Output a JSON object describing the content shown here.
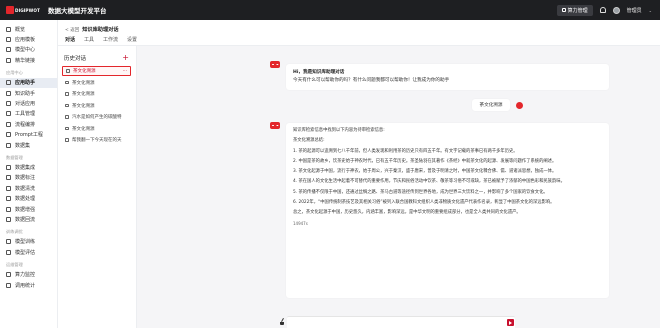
{
  "header": {
    "logo_text": "DIGIPWOT",
    "app_title": "数据大模型开发平台",
    "mgmt_label": "算力管理",
    "user_name": "管理员",
    "caret": "⌄"
  },
  "nav": {
    "items_top": [
      {
        "label": "概览",
        "icon": "home-icon"
      },
      {
        "label": "应用模板",
        "icon": "template-icon"
      },
      {
        "label": "模型中心",
        "icon": "model-icon"
      },
      {
        "label": "精华链接",
        "icon": "link-icon"
      }
    ],
    "group1": "应用中心",
    "items_app": [
      {
        "label": "应用助手",
        "icon": "assistant-icon",
        "active": true
      },
      {
        "label": "知识助手",
        "icon": "knowledge-icon"
      },
      {
        "label": "对话应用",
        "icon": "chat-icon"
      },
      {
        "label": "工具管理",
        "icon": "tool-icon"
      },
      {
        "label": "流程编排",
        "icon": "flow-icon"
      },
      {
        "label": "Prompt工程",
        "icon": "prompt-icon"
      },
      {
        "label": "数据集",
        "icon": "dataset-icon"
      }
    ],
    "group2": "数据管理",
    "items_data": [
      {
        "label": "数据集成",
        "icon": "integration-icon"
      },
      {
        "label": "数据标注",
        "icon": "label-icon"
      },
      {
        "label": "数据清洗",
        "icon": "clean-icon"
      },
      {
        "label": "数据处理",
        "icon": "process-icon"
      },
      {
        "label": "数据增强",
        "icon": "enhance-icon"
      },
      {
        "label": "数据回流",
        "icon": "backflow-icon"
      }
    ],
    "group3": "训练调优",
    "items_train": [
      {
        "label": "模型训练",
        "icon": "train-icon"
      },
      {
        "label": "模型评估",
        "icon": "eval-icon"
      }
    ],
    "group4": "运维管理",
    "items_ops": [
      {
        "label": "算力监控",
        "icon": "monitor-icon"
      },
      {
        "label": "调用统计",
        "icon": "stats-icon"
      }
    ]
  },
  "subheader": {
    "back_label": "< 返回",
    "title": "知识库助理对话",
    "tabs": [
      "对话",
      "工具",
      "工作流",
      "设置"
    ]
  },
  "history": {
    "title": "历史对话",
    "add": "+",
    "items": [
      {
        "label": "茶文化溯源",
        "active": true,
        "dots": "···"
      },
      {
        "label": "茶文化溯源"
      },
      {
        "label": "茶文化溯源"
      },
      {
        "label": "茶文化溯源"
      },
      {
        "label": "汽水是如何产生的碳酸特"
      },
      {
        "label": "茶文化溯源"
      },
      {
        "label": "帮我翻一下今天现在的天"
      }
    ]
  },
  "chat": {
    "welcome_title": "Hi，我是知识库助理对话",
    "welcome_text": "今天有什么可以帮助你的吗？有什么问题我都可以帮助你！让我成为你的助手",
    "user_message": "茶文化溯源",
    "answer": {
      "intro": "知识库检索信息中找到以下内容为待审检索信息:",
      "heading": "茶文化溯源总结:",
      "items": [
        "1. 茶的起源可以追溯到七八千年前，但人类发现和利用茶的历史只有四五千年。有文字记载的茶事已有两千多年历史。",
        "2. 中国是茶的故乡，饮茶史始于神农时代，已有五千年历史。茶圣陆羽在其著作《茶经》中就茶文化的起源、发展等问题作了系统的阐述。",
        "3. 茶文化起源于中国，流行于神农，始于周公，兴于秦汉，盛于唐宋，普及于明清之时，中国茶文化糅合佛、儒、道诸派思想，独成一体。",
        "4. 茶在国人的文化生活中起着不可替代的重要作用，节庆和民俗活动中饮茶、敬茶等习俗不可或缺，茶已被赋予了浓郁的中国色彩和民族韵味。",
        "5. 茶的传播不仅限于中国，还通过丝绸之路、茶马古道等途径传到世界各地，成为世界三大饮料之一，并影响了多个国家的饮食文化。",
        "6. 2022年，“中国传统制茶技艺及其相关习俗”被列入联合国教科文组织人类非物质文化遗产代表作名录，彰显了中国茶文化的深远影响。"
      ],
      "summary": "总之，茶文化起源于中国，历史悠久，内涵丰富，影响深远，是中华文明的重要组成部分，也是全人类共同的文化遗产。",
      "tokens": "14947s"
    }
  },
  "input": {
    "placeholder": ""
  },
  "colors": {
    "brand_red": "#c8102e",
    "topbar": "#1e1f22",
    "active_nav": "#e8ecf3"
  }
}
